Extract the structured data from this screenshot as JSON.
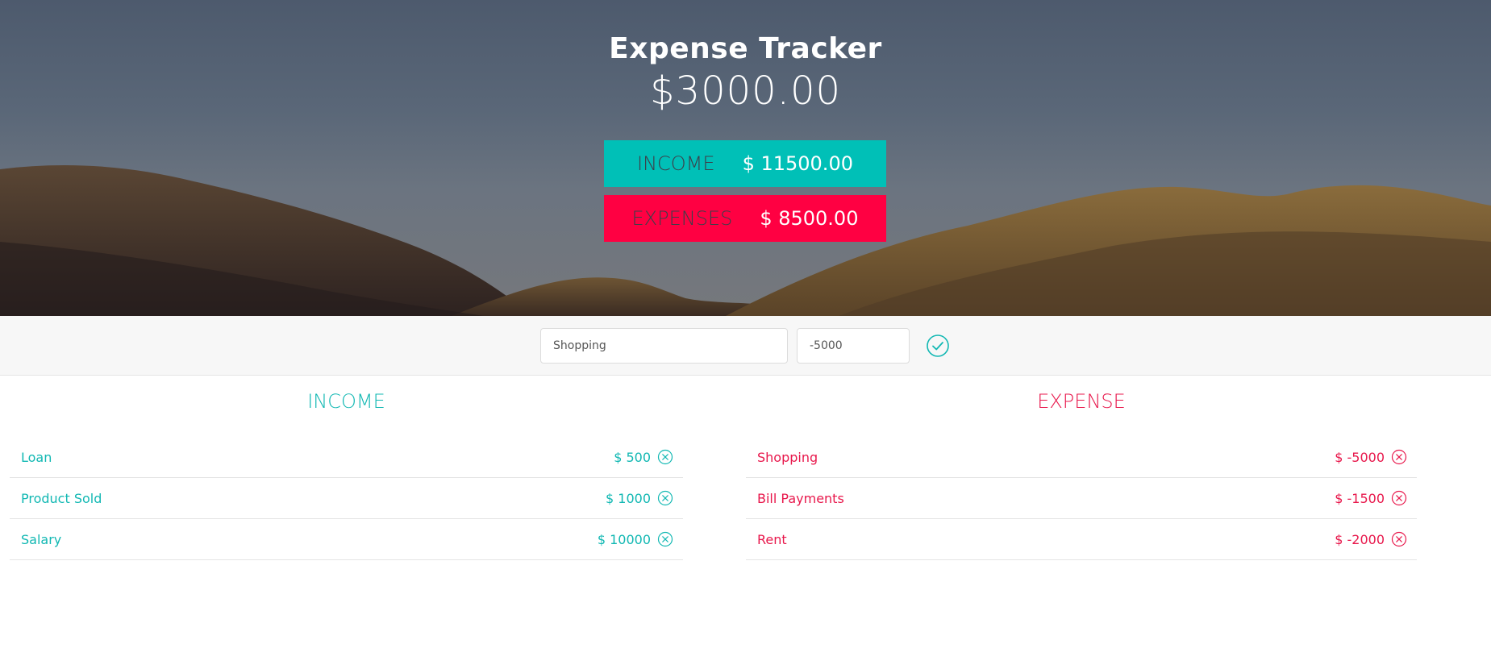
{
  "header": {
    "title": "Expense Tracker",
    "balance": "$3000.00"
  },
  "summary": {
    "income_label": "INCOME",
    "income_value": "$ 11500.00",
    "expenses_label": "EXPENSES",
    "expenses_value": "$ 8500.00"
  },
  "form": {
    "description_value": "Shopping",
    "amount_value": "-5000",
    "submit_icon": "check-circle-icon"
  },
  "income": {
    "title": "INCOME",
    "items": [
      {
        "description": "Loan",
        "amount": "$ 500"
      },
      {
        "description": "Product Sold",
        "amount": "$ 1000"
      },
      {
        "description": "Salary",
        "amount": "$ 10000"
      }
    ]
  },
  "expense": {
    "title": "EXPENSE",
    "items": [
      {
        "description": "Shopping",
        "amount": "$ -5000"
      },
      {
        "description": "Bill Payments",
        "amount": "$ -1500"
      },
      {
        "description": "Rent",
        "amount": "$ -2000"
      }
    ]
  },
  "colors": {
    "income_accent": "#00c0b7",
    "expense_accent": "#ff0042",
    "income_text": "#12b8b3",
    "expense_text": "#e8184c"
  }
}
